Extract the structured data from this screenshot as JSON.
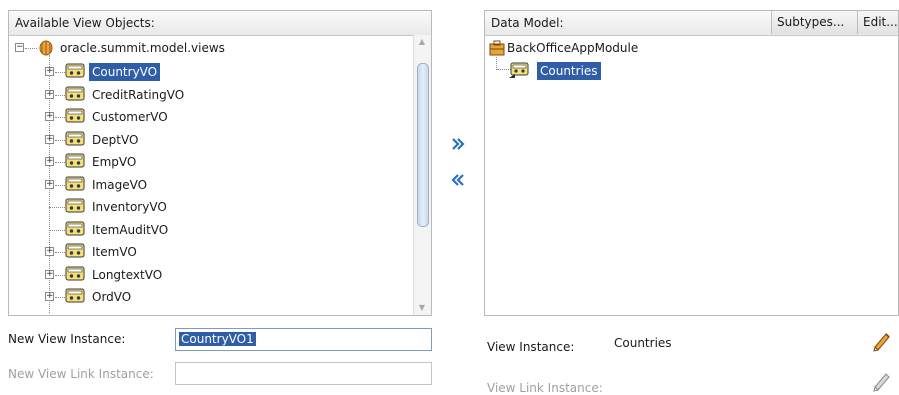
{
  "available": {
    "header": "Available View Objects:",
    "package": "oracle.summit.model.views",
    "items": [
      {
        "label": "CountryVO",
        "expandable": true,
        "selected": true
      },
      {
        "label": "CreditRatingVO",
        "expandable": true
      },
      {
        "label": "CustomerVO",
        "expandable": true
      },
      {
        "label": "DeptVO",
        "expandable": true
      },
      {
        "label": "EmpVO",
        "expandable": true
      },
      {
        "label": "ImageVO",
        "expandable": true
      },
      {
        "label": "InventoryVO",
        "expandable": false
      },
      {
        "label": "ItemAuditVO",
        "expandable": false
      },
      {
        "label": "ItemVO",
        "expandable": true
      },
      {
        "label": "LongtextVO",
        "expandable": true
      },
      {
        "label": "OrdVO",
        "expandable": true
      }
    ]
  },
  "shuttle": {
    "add_icon": "double-chevron-right-icon",
    "remove_icon": "double-chevron-left-icon"
  },
  "data_model": {
    "header": "Data Model:",
    "subtypes_label": "Subtypes...",
    "edit_label": "Edit...",
    "module": "BackOfficeAppModule",
    "instance": "Countries"
  },
  "form": {
    "new_view_instance_label": "New View Instance:",
    "new_view_instance_value": "CountryVO1",
    "new_view_link_instance_label": "New View Link Instance:",
    "view_instance_label": "View Instance:",
    "view_instance_value": "Countries",
    "view_link_instance_label": "View Link Instance:"
  },
  "colors": {
    "selection": "#2f5ea7",
    "arrow": "#2b6fc5",
    "pencil_active": "#e08a1e",
    "pencil_disabled": "#9a9a9a"
  }
}
